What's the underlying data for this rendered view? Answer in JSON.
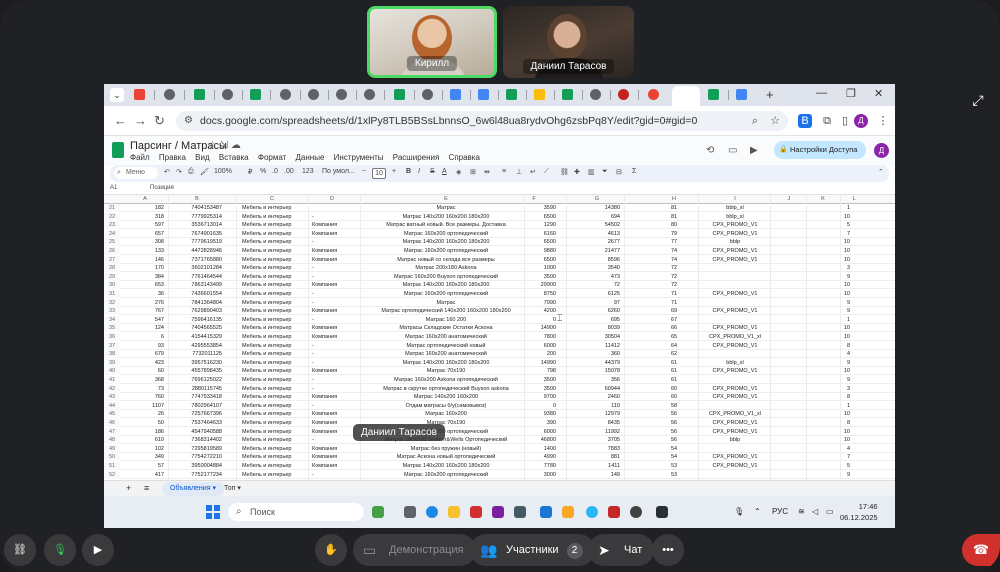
{
  "participants": [
    {
      "name": "Кирилл",
      "speaking": true
    },
    {
      "name": "Даниил Тарасов",
      "speaking": false
    }
  ],
  "browser": {
    "url": "docs.google.com/spreadsheets/d/1xlPy8TLB5BSsLbnnsO_6w6l48ua8rydvOhg6zsbPq8Y/edit?gid=0#gid=0",
    "tab_plus": "+",
    "win_controls": [
      "—",
      "❐",
      "✕"
    ]
  },
  "sheets": {
    "title": "Парсинг / Матрасы",
    "menu": [
      "Файл",
      "Правка",
      "Вид",
      "Вставка",
      "Формат",
      "Данные",
      "Инструменты",
      "Расширения",
      "Справка"
    ],
    "share_label": "Настройки Доступа",
    "avatar_letter": "Д",
    "toolbar": {
      "search": "Меню",
      "zoom": "100%",
      "number_format": "123",
      "font": "По умол...",
      "font_size": "10"
    },
    "cell_ref": "A1",
    "formula": "Позиция",
    "columns": [
      "A",
      "B",
      "C",
      "D",
      "E",
      "F",
      "G",
      "H",
      "I",
      "J",
      "K",
      "L"
    ],
    "rows": [
      {
        "n": "21",
        "a": "182",
        "b": "7404153487",
        "c": "Мебель и интерьер",
        "d": "",
        "e": "Матрас",
        "f": "3590",
        "g": "14380",
        "h": "81",
        "i": "bblp_xl",
        "l": "1"
      },
      {
        "n": "22",
        "a": "318",
        "b": "7779925314",
        "c": "Мебель и интерьер",
        "d": "-",
        "e": "Матрас 140x200 160x200 180x200",
        "f": "6500",
        "g": "694",
        "h": "81",
        "i": "bblp_xl",
        "l": "10"
      },
      {
        "n": "23",
        "a": "597",
        "b": "3536713014",
        "c": "Мебель и интерьер",
        "d": "Компания",
        "e": "Матрас ватный новый. Все размеры. Доставка",
        "f": "1290",
        "g": "54502",
        "h": "80",
        "i": "CPX_PROMO_V1",
        "l": "5"
      },
      {
        "n": "24",
        "a": "657",
        "b": "7674901635",
        "c": "Мебель и интерьер",
        "d": "Компания",
        "e": "Матрас 160x200 ортопедический",
        "f": "6160",
        "g": "4613",
        "h": "79",
        "i": "CPX_PROMO_V1",
        "l": "7"
      },
      {
        "n": "25",
        "a": "308",
        "b": "7779619519",
        "c": "Мебель и интерьер",
        "d": "-",
        "e": "Матрас 140x200 160x200 180x200",
        "f": "6500",
        "g": "2677",
        "h": "77",
        "i": "bblp",
        "l": "10"
      },
      {
        "n": "26",
        "a": "133",
        "b": "4472828946",
        "c": "Мебель и интерьер",
        "d": "Компания",
        "e": "Матрас 160x200 ортопедический",
        "f": "9880",
        "g": "21477",
        "h": "74",
        "i": "CPX_PROMO_V1",
        "l": "10"
      },
      {
        "n": "27",
        "a": "146",
        "b": "7371765880",
        "c": "Мебель и интерьер",
        "d": "Компания",
        "e": "Матрас новый со склада все размеры",
        "f": "6500",
        "g": "8596",
        "h": "74",
        "i": "CPX_PROMO_V1",
        "l": "10"
      },
      {
        "n": "28",
        "a": "170",
        "b": "3602101284",
        "c": "Мебель и интерьер",
        "d": "-",
        "e": "Матрас 200x180 Askona",
        "f": "1000",
        "g": "3540",
        "h": "72",
        "i": "",
        "l": "3"
      },
      {
        "n": "29",
        "a": "384",
        "b": "7761464544",
        "c": "Мебель и интерьер",
        "d": "-",
        "e": "Матрас 160x200 Buyson ортопедический",
        "f": "3500",
        "g": "473",
        "h": "72",
        "i": "",
        "l": "9"
      },
      {
        "n": "30",
        "a": "653",
        "b": "7863143499",
        "c": "Мебель и интерьер",
        "d": "Компания",
        "e": "Матрас 140x200 160x200 180x200",
        "f": "29900",
        "g": "72",
        "h": "72",
        "i": "",
        "l": "10"
      },
      {
        "n": "31",
        "a": "36",
        "b": "7436601554",
        "c": "Мебель и интерьер",
        "d": "-",
        "e": "Матрас 160x200 ортопедический",
        "f": "8750",
        "g": "6125",
        "h": "71",
        "i": "CPX_PROMO_V1",
        "l": "10"
      },
      {
        "n": "32",
        "a": "276",
        "b": "7841364804",
        "c": "Мебель и интерьер",
        "d": "-",
        "e": "Матрас",
        "f": "7990",
        "g": "97",
        "h": "71",
        "i": "",
        "l": "9"
      },
      {
        "n": "33",
        "a": "767",
        "b": "7629890403",
        "c": "Мебель и интерьер",
        "d": "Компания",
        "e": "Матрас ортопедический 140x200 160x200 180x200",
        "f": "4200",
        "g": "6260",
        "h": "69",
        "i": "CPX_PROMO_V1",
        "l": "9"
      },
      {
        "n": "34",
        "a": "547",
        "b": "7596416135",
        "c": "Мебель и интерьер",
        "d": "-",
        "e": "Матрас 160 200",
        "f": "0",
        "g": "695",
        "h": "67",
        "i": "",
        "l": "1"
      },
      {
        "n": "35",
        "a": "124",
        "b": "7404565525",
        "c": "Мебель и интерьер",
        "d": "Компания",
        "e": "Матрасы Складские Остатки Аскона",
        "f": "14900",
        "g": "8039",
        "h": "66",
        "i": "CPX_PROMO_V1",
        "l": "10"
      },
      {
        "n": "36",
        "a": "6",
        "b": "4154415329",
        "c": "Мебель и интерьер",
        "d": "Компания",
        "e": "Матрас 160x200 анатомический",
        "f": "7800",
        "g": "30504",
        "h": "65",
        "i": "CPX_PROMO_V1_xl",
        "l": "10"
      },
      {
        "n": "37",
        "a": "93",
        "b": "4295553854",
        "c": "Мебель и интерьер",
        "d": "-",
        "e": "Матрас ортопедический новый",
        "f": "6000",
        "g": "11412",
        "h": "64",
        "i": "CPX_PROMO_V1",
        "l": "8"
      },
      {
        "n": "38",
        "a": "679",
        "b": "7732011125",
        "c": "Мебель и интерьер",
        "d": "-",
        "e": "Матрас 160x200 анатомический",
        "f": "200",
        "g": "360",
        "h": "62",
        "i": "",
        "l": "4"
      },
      {
        "n": "39",
        "a": "423",
        "b": "3957516230",
        "c": "Мебель и интерьер",
        "d": "-",
        "e": "Матрас 140x200 160x200 180x200",
        "f": "14990",
        "g": "44379",
        "h": "61",
        "i": "bblp_xl",
        "l": "9"
      },
      {
        "n": "40",
        "a": "60",
        "b": "4557898435",
        "c": "Мебель и интерьер",
        "d": "Компания",
        "e": "Матрас 70x190",
        "f": "798",
        "g": "15078",
        "h": "61",
        "i": "CPX_PROMO_V1",
        "l": "10"
      },
      {
        "n": "41",
        "a": "368",
        "b": "7696125022",
        "c": "Мебель и интерьер",
        "d": "-",
        "e": "Матрас 160x200 Askona ортопедический",
        "f": "3500",
        "g": "356",
        "h": "61",
        "i": "",
        "l": "9"
      },
      {
        "n": "42",
        "a": "73",
        "b": "2880115745",
        "c": "Мебель и интерьер",
        "d": "-",
        "e": "Матрас в скрутке ортопедический Buyson askona",
        "f": "3500",
        "g": "60944",
        "h": "60",
        "i": "CPX_PROMO_V1",
        "l": "3"
      },
      {
        "n": "43",
        "a": "760",
        "b": "7747933418",
        "c": "Мебель и интерьер",
        "d": "Компания",
        "e": "Матрас 140x200 160x200",
        "f": "9700",
        "g": "2460",
        "h": "60",
        "i": "CPX_PROMO_V1",
        "l": "8"
      },
      {
        "n": "44",
        "a": "1107",
        "b": "7802964107",
        "c": "Мебель и интерьер",
        "d": "-",
        "e": "Отдам матрасы б/у(самовывоз)",
        "f": "0",
        "g": "110",
        "h": "58",
        "i": "",
        "l": "1"
      },
      {
        "n": "45",
        "a": "26",
        "b": "7257667396",
        "c": "Мебель и интерьер",
        "d": "Компания",
        "e": "Матрас 160x200",
        "f": "9380",
        "g": "12979",
        "h": "56",
        "i": "CPX_PROMO_V1_xl",
        "l": "10"
      },
      {
        "n": "46",
        "a": "50",
        "b": "7537464633",
        "c": "Мебель и интерьер",
        "d": "Компания",
        "e": "Матрас 70x190",
        "f": "390",
        "g": "8435",
        "h": "56",
        "i": "CPX_PROMO_V1",
        "l": "8"
      },
      {
        "n": "47",
        "a": "186",
        "b": "4547940588",
        "c": "Мебель и интерьер",
        "d": "Компания",
        "e": "Матрас 180x200 ортопедический",
        "f": "6000",
        "g": "11992",
        "h": "56",
        "i": "CPX_PROMO_V1",
        "l": "10"
      },
      {
        "n": "48",
        "a": "610",
        "b": "7368314402",
        "c": "Мебель и интерьер",
        "d": "-",
        "e": "Матрас 180x200 Grether&Wells Ортопедический",
        "f": "46800",
        "g": "3705",
        "h": "56",
        "i": "bblp",
        "l": "10"
      },
      {
        "n": "49",
        "a": "102",
        "b": "7295819589",
        "c": "Мебель и интерьер",
        "d": "Компания",
        "e": "Матрас без пружин (новый)",
        "f": "1400",
        "g": "7883",
        "h": "54",
        "i": "",
        "l": "4"
      },
      {
        "n": "50",
        "a": "349",
        "b": "7754272210",
        "c": "Мебель и интерьер",
        "d": "Компания",
        "e": "Матрас Аскона новый ортопедический",
        "f": "4990",
        "g": "881",
        "h": "54",
        "i": "CPX_PROMO_V1",
        "l": "7"
      },
      {
        "n": "51",
        "a": "57",
        "b": "3950004884",
        "c": "Мебель и интерьер",
        "d": "Компания",
        "e": "Матрас 140x200 160x200 180x200",
        "f": "7780",
        "g": "1411",
        "h": "53",
        "i": "CPX_PROMO_V1",
        "l": "5"
      },
      {
        "n": "52",
        "a": "417",
        "b": "7752177234",
        "c": "Мебель и интерьер",
        "d": "-",
        "e": "Матрас 160x200 ортопедический",
        "f": "3000",
        "g": "149",
        "h": "53",
        "i": "",
        "l": "9"
      }
    ],
    "sheet_tabs": [
      "Объявления",
      "Топ"
    ]
  },
  "taskbar": {
    "search": "Поиск",
    "lang": "РУС",
    "time": "17:46",
    "date": "06.12.2025"
  },
  "speaker_label": "Даниил Тарасов",
  "controls": {
    "demo": "Демонстрация",
    "participants": "Участники",
    "participants_count": "2",
    "chat": "Чат"
  },
  "colors": {
    "speaking_border": "#4cd964",
    "hangup": "#d0312d",
    "sheets_green": "#0f9d58",
    "share_button": "#c2e7ff"
  }
}
